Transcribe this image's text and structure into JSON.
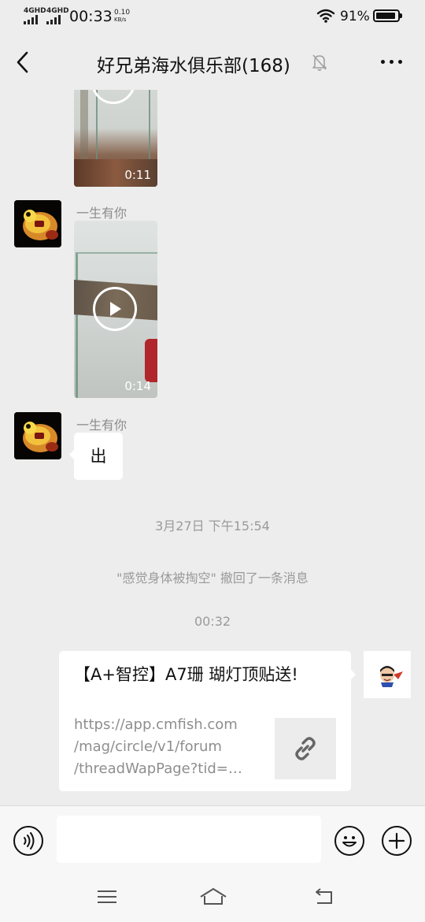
{
  "status_bar": {
    "net1": "4GHD",
    "net2": "4GHD",
    "time": "00:33",
    "speed_value": "0.10",
    "speed_unit": "KB/s",
    "battery_pct": "91%",
    "battery_level": 0.91
  },
  "header": {
    "title": "好兄弟海水俱乐部(168)"
  },
  "messages": {
    "video1": {
      "duration": "0:11"
    },
    "msg2": {
      "sender": "一生有你",
      "duration": "0:14"
    },
    "msg3": {
      "sender": "一生有你",
      "text": "出"
    },
    "timestamp1": "3月27日 下午15:54",
    "recall_notice": "\"感觉身体被掏空\" 撤回了一条消息",
    "timestamp2": "00:32",
    "link_card": {
      "title": "【A+智控】A7珊 瑚灯顶贴送!",
      "url": "https://app.cmfish.com/mag/circle/v1/forum/threadWapPage?tid=…",
      "url_lines": [
        "https://app.cmfish.com",
        "/mag/circle/v1/forum",
        "/threadWapPage?tid=…"
      ]
    }
  },
  "colors": {
    "background": "#ededed",
    "bubble": "#ffffff",
    "meta_text": "#9a9a9a"
  },
  "icons": {
    "back": "chevron-left-icon",
    "mute": "bell-off-icon",
    "more": "more-icon",
    "voice": "voice-icon",
    "emoji": "emoji-icon",
    "plus": "plus-icon",
    "link": "link-icon"
  }
}
